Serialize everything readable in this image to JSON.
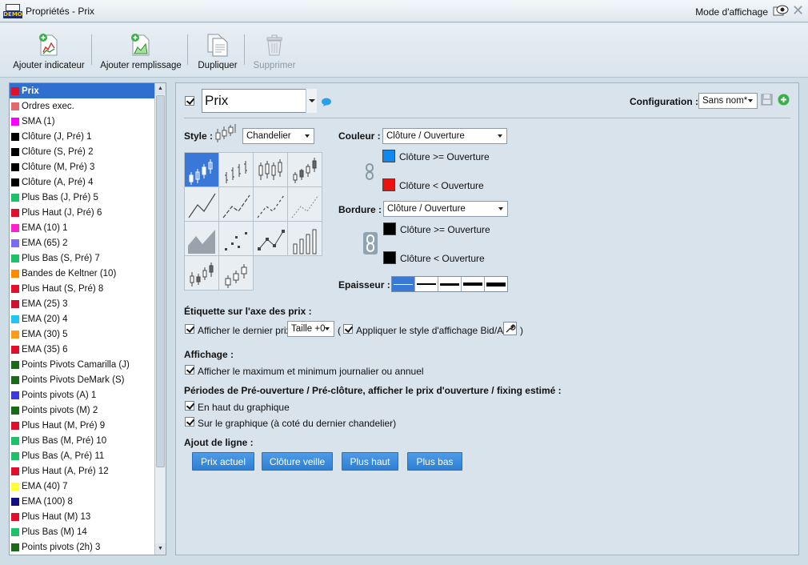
{
  "window": {
    "title": "Propriétés - Prix",
    "logo_text": "DEMO",
    "display_mode_label": "Mode d'affichage"
  },
  "toolbar": {
    "add_indicator": "Ajouter indicateur",
    "add_fill": "Ajouter remplissage",
    "duplicate": "Dupliquer",
    "delete": "Supprimer"
  },
  "list": {
    "items": [
      {
        "label": "Prix",
        "color": "#e0102a",
        "selected": true
      },
      {
        "label": "Ordres exec.",
        "color": "#e36a6a"
      },
      {
        "label": "SMA (1)",
        "color": "#ff00ff"
      },
      {
        "label": "Clôture (J, Pré) 1",
        "color": "#000000"
      },
      {
        "label": "Clôture (S, Pré) 2",
        "color": "#000000"
      },
      {
        "label": "Clôture (M, Pré) 3",
        "color": "#000000"
      },
      {
        "label": "Clôture (A, Pré) 4",
        "color": "#000000"
      },
      {
        "label": "Plus Bas (J, Pré) 5",
        "color": "#1fc06a"
      },
      {
        "label": "Plus Haut (J, Pré) 6",
        "color": "#e0102a"
      },
      {
        "label": "EMA (10) 1",
        "color": "#ff22cc"
      },
      {
        "label": "EMA (65) 2",
        "color": "#7a6cf0"
      },
      {
        "label": "Plus Bas (S, Pré) 7",
        "color": "#1fc06a"
      },
      {
        "label": "Bandes de Keltner (10)",
        "color": "#ff8a00"
      },
      {
        "label": "Plus Haut (S, Pré) 8",
        "color": "#e0102a"
      },
      {
        "label": "EMA (25) 3",
        "color": "#d0102a"
      },
      {
        "label": "EMA (20) 4",
        "color": "#22c4f0"
      },
      {
        "label": "EMA (30) 5",
        "color": "#ff9c1a"
      },
      {
        "label": "EMA (35) 6",
        "color": "#e0102a"
      },
      {
        "label": "Points Pivots Camarilla (J)",
        "color": "#1a6a1a"
      },
      {
        "label": "Points Pivots DeMark (S)",
        "color": "#1a6a1a"
      },
      {
        "label": "Points pivots (A) 1",
        "color": "#3a3adf"
      },
      {
        "label": "Points pivots (M) 2",
        "color": "#1a6a1a"
      },
      {
        "label": "Plus Haut (M, Pré) 9",
        "color": "#e0102a"
      },
      {
        "label": "Plus Bas (M, Pré) 10",
        "color": "#1fc06a"
      },
      {
        "label": "Plus Bas (A, Pré) 11",
        "color": "#1fc06a"
      },
      {
        "label": "Plus Haut (A, Pré) 12",
        "color": "#e0102a"
      },
      {
        "label": "EMA (40) 7",
        "color": "#ffff33"
      },
      {
        "label": "EMA (100) 8",
        "color": "#101080"
      },
      {
        "label": "Plus Haut (M) 13",
        "color": "#e0102a"
      },
      {
        "label": "Plus Bas (M) 14",
        "color": "#1fc06a"
      },
      {
        "label": "Points pivots (2h) 3",
        "color": "#1a6a1a"
      }
    ]
  },
  "panel": {
    "name_value": "Prix",
    "configuration_label": "Configuration :",
    "configuration_value": "Sans nom*",
    "style_label": "Style :",
    "style_value": "Chandelier",
    "couleur_label": "Couleur :",
    "couleur_value": "Clôture / Ouverture",
    "color_up_label": "Clôture >= Ouverture",
    "color_up": "#1188ee",
    "color_down_label": "Clôture < Ouverture",
    "color_down": "#ee1111",
    "bordure_label": "Bordure :",
    "bordure_value": "Clôture / Ouverture",
    "border_up_label": "Clôture >= Ouverture",
    "border_up": "#000000",
    "border_down_label": "Clôture < Ouverture",
    "border_down": "#000000",
    "epaisseur_label": "Epaisseur :",
    "price_axis_section": "Étiquette sur l'axe des prix :",
    "show_last_price": "Afficher le dernier prix",
    "size_value": "Taille +0",
    "open_paren": "(",
    "apply_bid_ask": "Appliquer le style d'affichage Bid/Ask",
    "close_paren": ")",
    "display_section": "Affichage :",
    "show_max_min": "Afficher le maximum et minimum journalier ou annuel",
    "preopen_section": "Périodes de Pré-ouverture / Pré-clôture, afficher le prix d'ouverture / fixing estimé :",
    "top_of_chart": "En haut du graphique",
    "on_chart": "Sur le graphique (à coté du dernier chandelier)",
    "line_section": "Ajout de ligne :",
    "btn_current_price": "Prix actuel",
    "btn_prev_close": "Clôture veille",
    "btn_high": "Plus haut",
    "btn_low": "Plus bas"
  }
}
